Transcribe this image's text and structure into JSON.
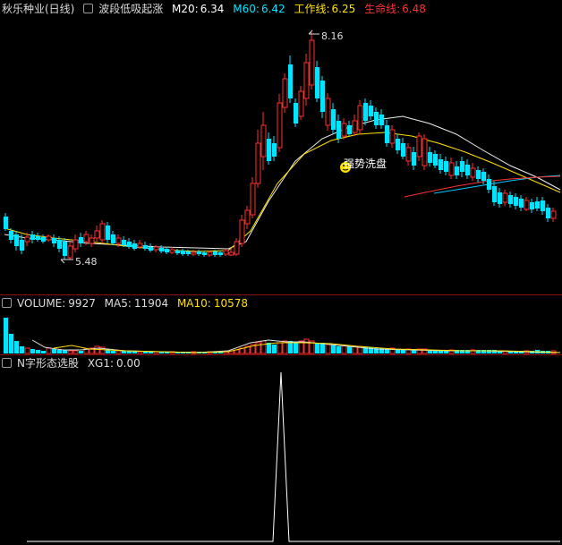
{
  "main": {
    "stock_title": "秋乐种业(日线)",
    "indicator_name": "波段低吸起涨",
    "m20_label": "M20:",
    "m20_value": "6.34",
    "m60_label": "M60:",
    "m60_value": "6.42",
    "work_label": "工作线:",
    "work_value": "6.25",
    "life_label": "生命线:",
    "life_value": "6.48",
    "high_label": "8.16",
    "low_label": "5.48",
    "signal_text": "强势洗盘",
    "colors": {
      "up": "#ff3030",
      "down": "#00e5ff",
      "m20": "#ffffff",
      "m60": "#00e5ff",
      "work": "#ffe000",
      "life": "#ff3030"
    }
  },
  "volume": {
    "title": "VOLUME:",
    "value": "9927",
    "ma5_label": "MA5:",
    "ma5_value": "11904",
    "ma10_label": "MA10:",
    "ma10_value": "10578"
  },
  "xg": {
    "title": "N字形态选股",
    "xg1_label": "XG1:",
    "xg1_value": "0.00"
  },
  "icons": {
    "gear": "indicator-settings-icon",
    "smiley": "smiley-signal-icon"
  }
}
